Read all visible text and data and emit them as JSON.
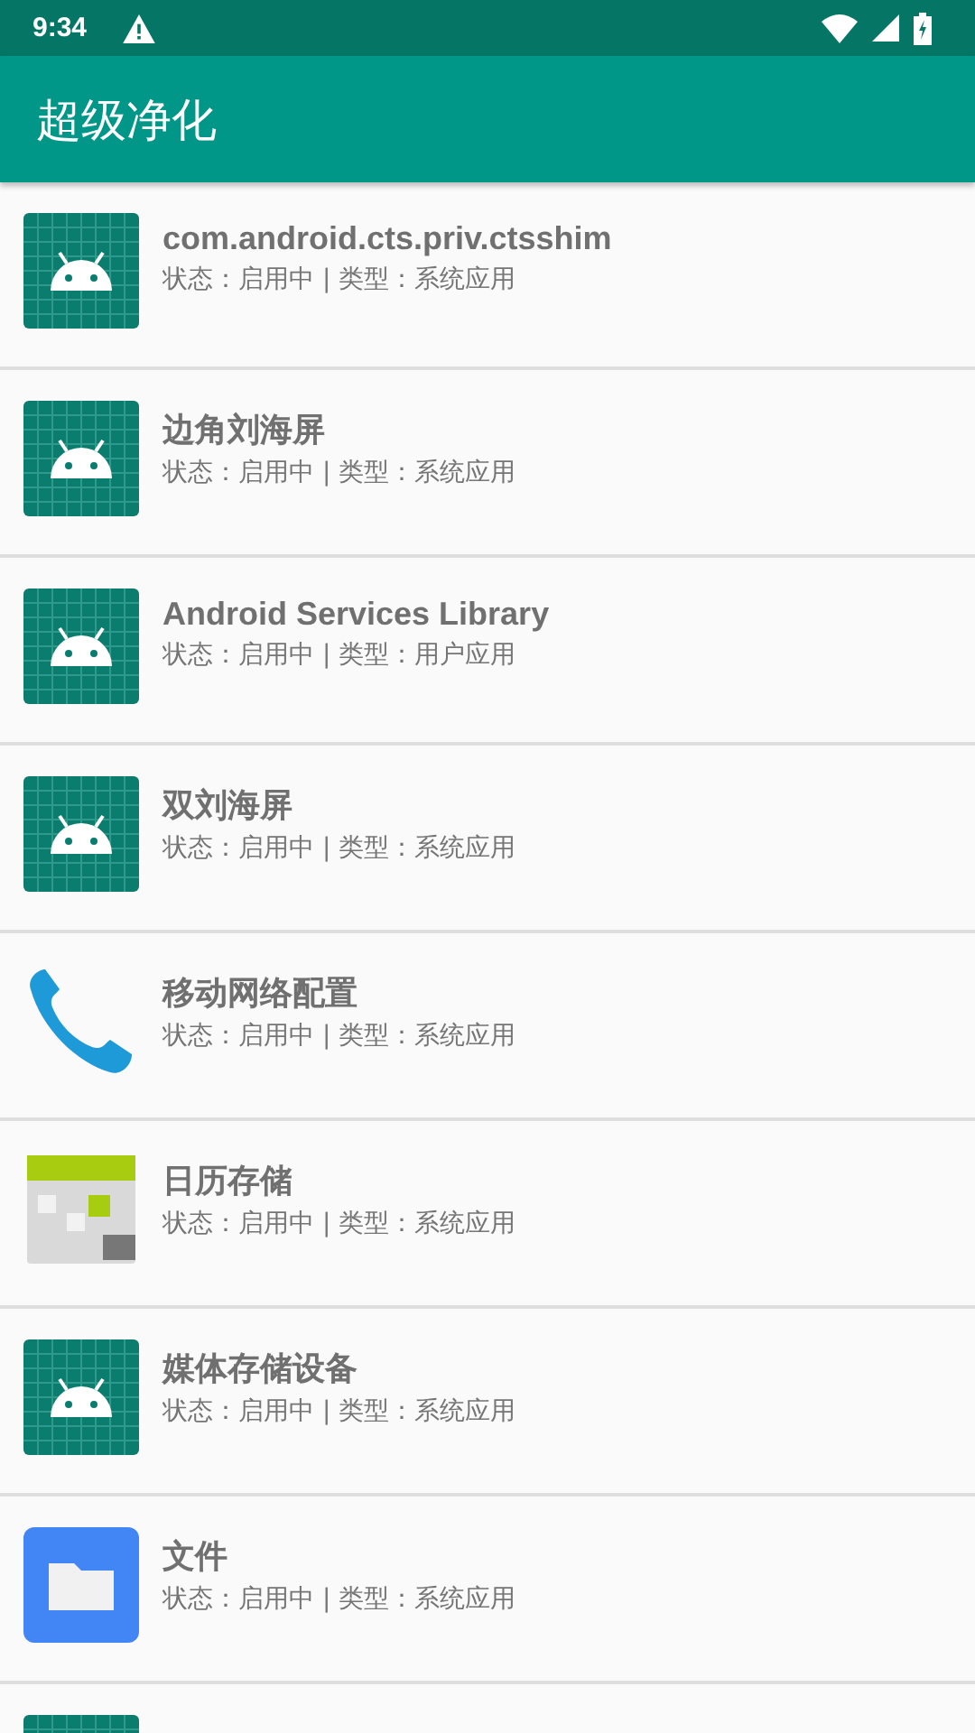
{
  "status_bar": {
    "time": "9:34"
  },
  "app_bar": {
    "title": "超级净化"
  },
  "apps": [
    {
      "name": "com.android.cts.priv.ctsshim",
      "info": "状态：启用中 | 类型：系统应用",
      "kind": "android"
    },
    {
      "name": "边角刘海屏",
      "info": "状态：启用中 | 类型：系统应用",
      "kind": "android"
    },
    {
      "name": "Android Services Library",
      "info": "状态：启用中 | 类型：用户应用",
      "kind": "android"
    },
    {
      "name": "双刘海屏",
      "info": "状态：启用中 | 类型：系统应用",
      "kind": "android"
    },
    {
      "name": "移动网络配置",
      "info": "状态：启用中 | 类型：系统应用",
      "kind": "phone"
    },
    {
      "name": "日历存储",
      "info": "状态：启用中 | 类型：系统应用",
      "kind": "calendar"
    },
    {
      "name": "媒体存储设备",
      "info": "状态：启用中 | 类型：系统应用",
      "kind": "android"
    },
    {
      "name": "文件",
      "info": "状态：启用中 | 类型：系统应用",
      "kind": "folder"
    },
    {
      "kind": "android"
    }
  ]
}
